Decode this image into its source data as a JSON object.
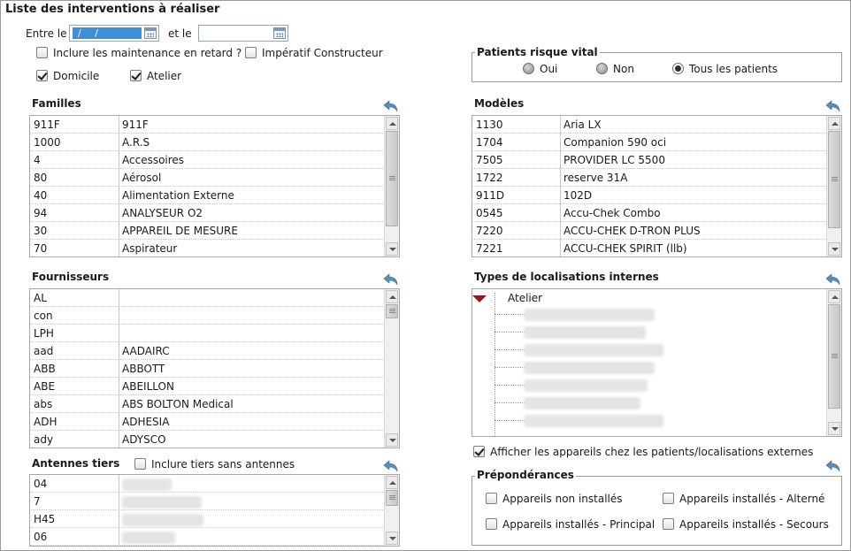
{
  "title": "Liste des interventions à réaliser",
  "dates": {
    "between_label": "Entre le",
    "from_value": "/ /",
    "and_label": "et le",
    "to_value": ""
  },
  "options": {
    "late_maintenance": {
      "label": "Inclure les maintenance en retard ?",
      "checked": false
    },
    "manufacturer": {
      "label": "Impératif Constructeur",
      "checked": false
    },
    "home": {
      "label": "Domicile",
      "checked": true
    },
    "workshop": {
      "label": "Atelier",
      "checked": true
    }
  },
  "vital_risk": {
    "title": "Patients risque vital",
    "options": [
      {
        "label": "Oui",
        "selected": false
      },
      {
        "label": "Non",
        "selected": false
      },
      {
        "label": "Tous les patients",
        "selected": true
      }
    ]
  },
  "families": {
    "title": "Familles",
    "rows": [
      {
        "code": "911F",
        "name": "911F"
      },
      {
        "code": "1000",
        "name": "A.R.S"
      },
      {
        "code": "4",
        "name": "Accessoires"
      },
      {
        "code": "80",
        "name": "Aérosol"
      },
      {
        "code": "40",
        "name": "Alimentation Externe"
      },
      {
        "code": "94",
        "name": "ANALYSEUR O2"
      },
      {
        "code": "30",
        "name": "APPAREIL DE MESURE"
      },
      {
        "code": "70",
        "name": "Aspirateur"
      }
    ]
  },
  "models": {
    "title": "Modèles",
    "rows": [
      {
        "code": "1130",
        "name": "Aria LX"
      },
      {
        "code": "1704",
        "name": "Companion 590 oci"
      },
      {
        "code": "7505",
        "name": "PROVIDER LC 5500"
      },
      {
        "code": "1722",
        "name": "reserve 31A"
      },
      {
        "code": "911D",
        "name": "102D"
      },
      {
        "code": "0545",
        "name": "Accu-Chek Combo"
      },
      {
        "code": "7220",
        "name": "ACCU-CHEK D-TRON PLUS"
      },
      {
        "code": "7221",
        "name": "ACCU-CHEK SPIRIT (llb)"
      }
    ]
  },
  "suppliers": {
    "title": "Fournisseurs",
    "rows": [
      {
        "code": "AL",
        "name": ""
      },
      {
        "code": "con",
        "name": ""
      },
      {
        "code": "LPH",
        "name": ""
      },
      {
        "code": "aad",
        "name": "AADAIRC"
      },
      {
        "code": "ABB",
        "name": "ABBOTT"
      },
      {
        "code": "ABE",
        "name": "ABEILLON"
      },
      {
        "code": "abs",
        "name": "ABS BOLTON Medical"
      },
      {
        "code": "ADH",
        "name": "ADHESIA"
      },
      {
        "code": "ady",
        "name": "ADYSCO"
      }
    ]
  },
  "location_types": {
    "title": "Types de localisations internes",
    "root": "Atelier"
  },
  "external_devices": {
    "label": "Afficher les appareils chez les patients/localisations externes",
    "checked": true
  },
  "third_antennas": {
    "title": "Antennes tiers",
    "include_label": "Inclure tiers sans antennes",
    "include_checked": false,
    "rows": [
      {
        "code": "04"
      },
      {
        "code": "7"
      },
      {
        "code": "H45"
      },
      {
        "code": "06"
      }
    ]
  },
  "preponderances": {
    "title": "Prépondérances",
    "items": [
      {
        "label": "Appareils non installés",
        "checked": false
      },
      {
        "label": "Appareils installés - Alterné",
        "checked": false
      },
      {
        "label": "Appareils installés - Principal",
        "checked": false
      },
      {
        "label": "Appareils installés - Secours",
        "checked": false
      }
    ]
  },
  "colors": {
    "accent": "#3d8fd6",
    "tree_arrow": "#8b1a1a",
    "back_icon": "#4d7faa"
  },
  "icons": {
    "calendar": "calendar-icon",
    "back": "back-arrow-icon",
    "expand": "triangle-down-icon"
  }
}
